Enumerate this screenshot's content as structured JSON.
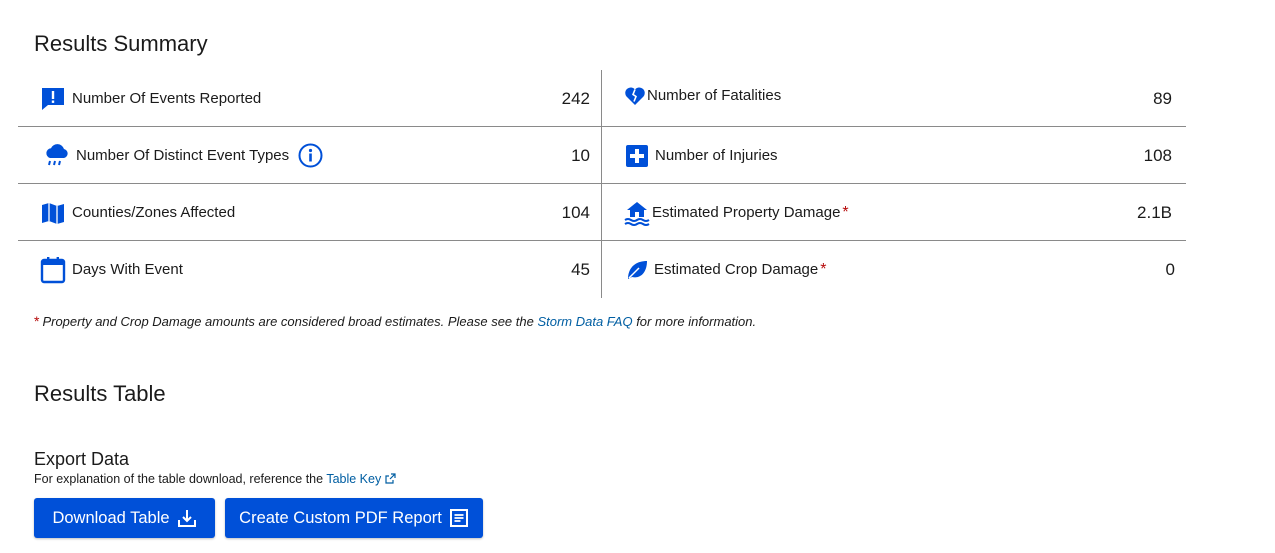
{
  "summary": {
    "title": "Results Summary",
    "left": [
      {
        "label": "Number Of Events Reported",
        "value": "242",
        "icon": "alert-message-icon"
      },
      {
        "label": "Number Of Distinct Event Types",
        "value": "10",
        "icon": "rain-cloud-icon"
      },
      {
        "label": "Counties/Zones Affected",
        "value": "104",
        "icon": "map-icon"
      },
      {
        "label": "Days With Event",
        "value": "45",
        "icon": "calendar-icon"
      }
    ],
    "right": [
      {
        "label": "Number of Fatalities",
        "value": "89",
        "icon": "broken-heart-icon"
      },
      {
        "label": "Number of Injuries",
        "value": "108",
        "icon": "medical-cross-icon"
      },
      {
        "label": "Estimated Property Damage",
        "value": "2.1B",
        "icon": "flooded-house-icon",
        "asterisk": "*"
      },
      {
        "label": "Estimated Crop Damage",
        "value": "0",
        "icon": "leaf-icon",
        "asterisk": "*"
      }
    ],
    "note": {
      "asterisk": "*",
      "before": "Property and Crop Damage amounts are considered broad estimates. Please see the ",
      "link": "Storm Data FAQ",
      "after": " for more information."
    }
  },
  "results_table": {
    "title": "Results Table"
  },
  "export": {
    "title": "Export Data",
    "desc_before": "For explanation of the table download, reference the ",
    "desc_link": "Table Key",
    "download_label": "Download Table",
    "pdf_label": "Create Custom PDF Report"
  },
  "colors": {
    "primary": "#0050d8",
    "icon_blue": "#0050d8",
    "link": "#005ea2",
    "asterisk_red": "#b50909"
  }
}
